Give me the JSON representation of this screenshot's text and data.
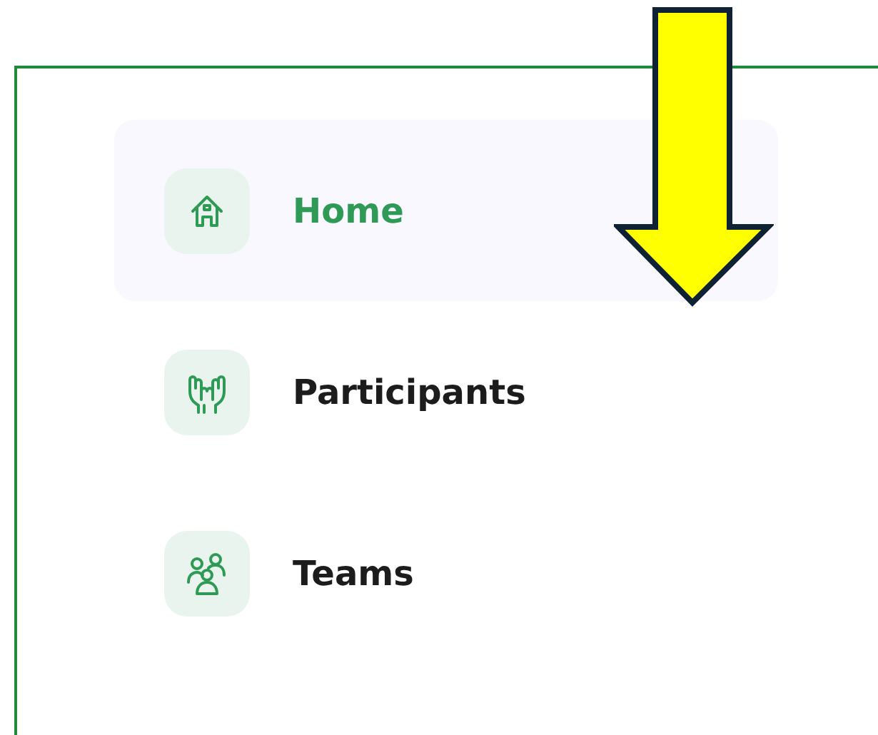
{
  "menu": {
    "items": [
      {
        "label": "Home",
        "kind": "home",
        "selected": true
      },
      {
        "label": "Participants",
        "kind": "hands",
        "selected": false
      },
      {
        "label": "Teams",
        "kind": "team",
        "selected": false
      }
    ]
  }
}
